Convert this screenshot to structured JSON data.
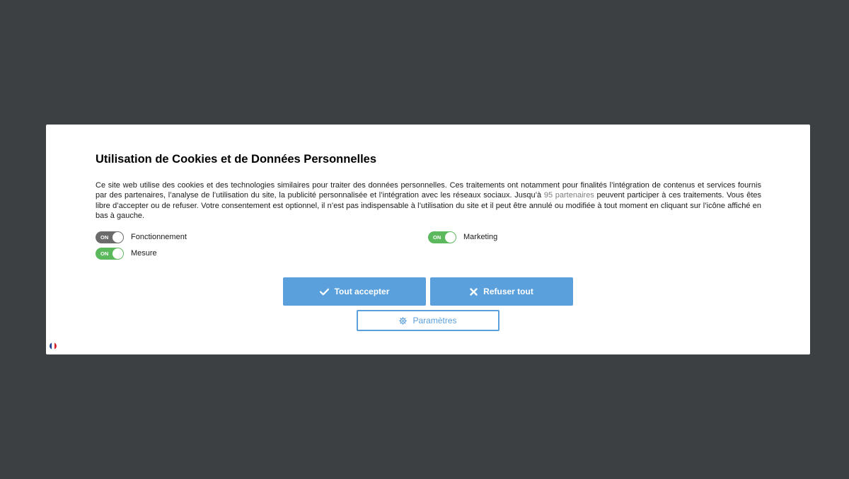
{
  "colors": {
    "backdrop": "#3c4043",
    "accent": "#5aa0dc",
    "toggle_on": "#5cb85c",
    "toggle_locked": "#6b6b6b"
  },
  "dialog": {
    "title": "Utilisation de Cookies et de Données Personnelles",
    "description_before_link": "Ce site web utilise des cookies et des technologies similaires pour traiter des données personnelles. Ces traitements ont notamment pour finalités l’intégration de contenus et services fournis par des partenaires, l’analyse de l’utilisation du site, la publicité personnalisée et l’intégration avec les réseaux sociaux. Jusqu’à ",
    "partners_link": "95 partenaires",
    "description_after_link": " peuvent participer à ces traitements. Vous êtes libre d’accepter ou de refuser. Votre consentement est optionnel, il n’est pas indispensable à l’utilisation du site et il peut être annulé ou modifiée à tout moment en cliquant sur l’icône affiché en bas à gauche."
  },
  "toggles": {
    "fonctionnement": {
      "label": "Fonctionnement",
      "state": "ON",
      "locked": true
    },
    "mesure": {
      "label": "Mesure",
      "state": "ON",
      "locked": false
    },
    "marketing": {
      "label": "Marketing",
      "state": "ON",
      "locked": false
    }
  },
  "buttons": {
    "accept_all": {
      "label": "Tout accepter",
      "icon": "check-icon"
    },
    "refuse_all": {
      "label": "Refuser tout",
      "icon": "close-icon"
    },
    "settings": {
      "label": "Paramètres",
      "icon": "gear-icon"
    }
  },
  "language_flag": {
    "icon": "french-flag-icon"
  }
}
